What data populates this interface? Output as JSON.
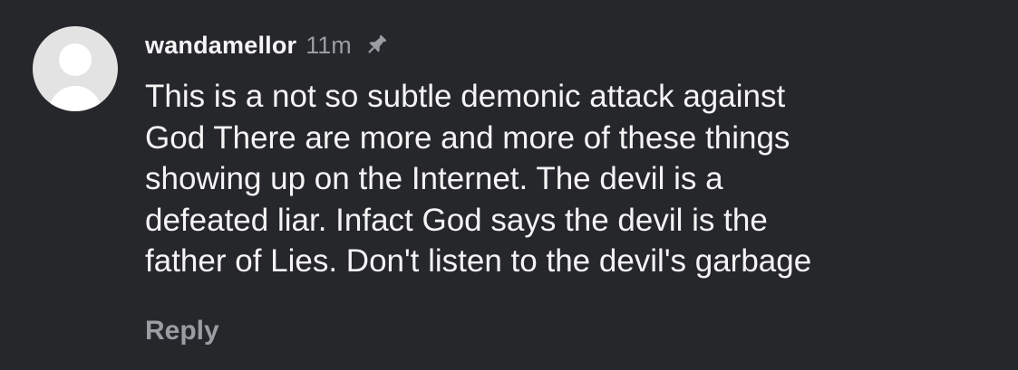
{
  "comment": {
    "username": "wandamellor",
    "timestamp": "11m",
    "pin_icon": "pin-icon",
    "avatar_icon": "default-avatar-icon",
    "text": "This is a not so subtle  demonic attack against\nGod There are more and more of these things\nshowing up on the Internet. The devil is a\ndefeated liar. Infact God says the devil is the\nfather of Lies. Don't listen to the devil's garbage",
    "reply_label": "Reply"
  },
  "colors": {
    "background": "#26272b",
    "text": "#f4f4f4",
    "muted": "#9a9da3",
    "avatar_bg": "#e3e3e3"
  }
}
